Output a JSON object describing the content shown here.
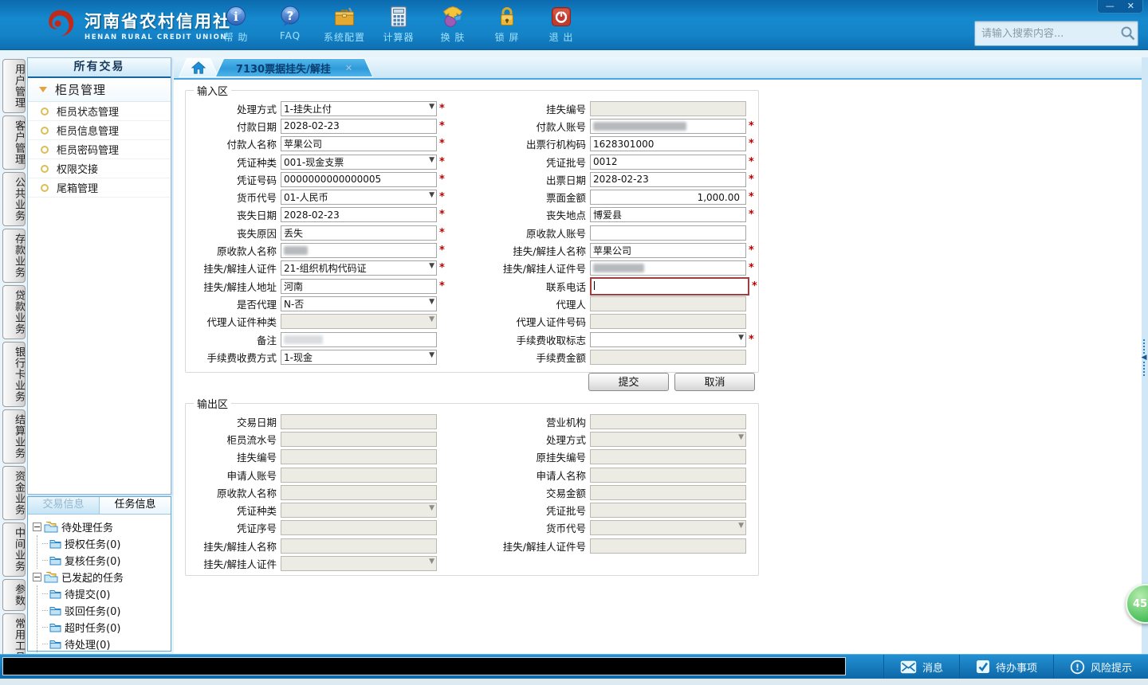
{
  "window": {
    "minimize": "—",
    "close": "✕"
  },
  "colors": {
    "header_blue": "#1583C8",
    "accent": "#2E9BDB",
    "required_red": "#C00000",
    "badge_green": "#52C260"
  },
  "header": {
    "brand_title": "河南省农村信用社",
    "brand_subtitle": "HENAN RURAL CREDIT UNION",
    "nav": [
      {
        "icon": "help-icon",
        "label": "帮 助"
      },
      {
        "icon": "faq-icon",
        "label": "FAQ"
      },
      {
        "icon": "settings-icon",
        "label": "系统配置"
      },
      {
        "icon": "calculator-icon",
        "label": "计算器"
      },
      {
        "icon": "skin-icon",
        "label": "换 肤"
      },
      {
        "icon": "lock-icon",
        "label": "锁 屏"
      },
      {
        "icon": "exit-icon",
        "label": "退 出"
      }
    ],
    "search_placeholder": "请输入搜索内容..."
  },
  "left_tabs": [
    "用户管理",
    "客户管理",
    "公共业务",
    "存款业务",
    "贷款业务",
    "银行卡业务",
    "结算业务",
    "资金业务",
    "中间业务",
    "参数",
    "常用工具"
  ],
  "sidebar": {
    "header": "所有交易",
    "group": "柜员管理",
    "items": [
      "柜员状态管理",
      "柜员信息管理",
      "柜员密码管理",
      "权限交接",
      "尾箱管理"
    ]
  },
  "tabs": {
    "active_label": "7130票据挂失/解挂",
    "close_glyph": "✕"
  },
  "form": {
    "required_mark": "*",
    "buttons": {
      "submit": "提交",
      "cancel": "取消"
    },
    "input": {
      "legend": "输入区",
      "rows": [
        {
          "left": {
            "name": "process-mode-select",
            "label": "处理方式",
            "value": "1-挂失止付",
            "type": "select",
            "required": true
          },
          "right": {
            "name": "loss-report-no-input",
            "label": "挂失编号",
            "value": "",
            "type": "text",
            "state": "disabled"
          }
        },
        {
          "left": {
            "name": "pay-date-input",
            "label": "付款日期",
            "value": "2028-02-23",
            "type": "text",
            "required": true
          },
          "right": {
            "name": "payer-account-input",
            "label": "付款人账号",
            "value": "",
            "type": "text",
            "state": "masked-wide",
            "required": true
          }
        },
        {
          "left": {
            "name": "payer-name-input",
            "label": "付款人名称",
            "value": "苹果公司",
            "type": "text",
            "required": true
          },
          "right": {
            "name": "issuing-bank-code-input",
            "label": "出票行机构码",
            "value": "1628301000",
            "type": "text",
            "required": true
          }
        },
        {
          "left": {
            "name": "voucher-type-select",
            "label": "凭证种类",
            "value": "001-现金支票",
            "type": "select",
            "required": true
          },
          "right": {
            "name": "voucher-batch-no-input",
            "label": "凭证批号",
            "value": "0012",
            "type": "text",
            "required": true
          }
        },
        {
          "left": {
            "name": "voucher-no-input",
            "label": "凭证号码",
            "value": "0000000000000005",
            "type": "text",
            "required": true
          },
          "right": {
            "name": "issue-date-input",
            "label": "出票日期",
            "value": "2028-02-23",
            "type": "text",
            "required": true
          }
        },
        {
          "left": {
            "name": "currency-select",
            "label": "货币代号",
            "value": "01-人民币",
            "type": "select",
            "required": true
          },
          "right": {
            "name": "face-amount-input",
            "label": "票面金额",
            "value": "1,000.00",
            "type": "text",
            "align": "right",
            "required": true
          }
        },
        {
          "left": {
            "name": "loss-date-input",
            "label": "丧失日期",
            "value": "2028-02-23",
            "type": "text",
            "required": true
          },
          "right": {
            "name": "loss-place-input",
            "label": "丧失地点",
            "value": "博爱县",
            "type": "text",
            "required": true
          }
        },
        {
          "left": {
            "name": "loss-reason-input",
            "label": "丧失原因",
            "value": "丢失",
            "type": "text",
            "required": true
          },
          "right": {
            "name": "original-payee-account-input",
            "label": "原收款人账号",
            "value": "",
            "type": "text"
          }
        },
        {
          "left": {
            "name": "original-payee-name-input",
            "label": "原收款人名称",
            "value": "",
            "type": "text",
            "state": "masked-sm",
            "required": true
          },
          "right": {
            "name": "applicant-name-input",
            "label": "挂失/解挂人名称",
            "value": "苹果公司",
            "type": "text",
            "required": true
          }
        },
        {
          "left": {
            "name": "applicant-cert-type-select",
            "label": "挂失/解挂人证件",
            "value": "21-组织机构代码证",
            "type": "select",
            "required": true
          },
          "right": {
            "name": "applicant-cert-no-input",
            "label": "挂失/解挂人证件号",
            "value": "",
            "type": "text",
            "state": "masked-med",
            "required": true
          }
        },
        {
          "left": {
            "name": "applicant-address-input",
            "label": "挂失/解挂人地址",
            "value": "河南",
            "type": "text",
            "required": true
          },
          "right": {
            "name": "contact-phone-input",
            "label": "联系电话",
            "value": "",
            "type": "text",
            "state": "focused",
            "required": true
          }
        },
        {
          "left": {
            "name": "is-agent-select",
            "label": "是否代理",
            "value": "N-否",
            "type": "select"
          },
          "right": {
            "name": "agent-name-input",
            "label": "代理人",
            "value": "",
            "type": "text",
            "state": "disabled"
          }
        },
        {
          "left": {
            "name": "agent-cert-type-select",
            "label": "代理人证件种类",
            "value": "",
            "type": "select",
            "state": "disabled"
          },
          "right": {
            "name": "agent-cert-no-input",
            "label": "代理人证件号码",
            "value": "",
            "type": "text",
            "state": "disabled"
          }
        },
        {
          "left": {
            "name": "remark-input",
            "label": "备注",
            "value": "",
            "type": "text",
            "state": "masked-light"
          },
          "right": {
            "name": "fee-charge-flag-select",
            "label": "手续费收取标志",
            "value": "",
            "type": "select",
            "required": true
          }
        },
        {
          "left": {
            "name": "fee-charge-mode-select",
            "label": "手续费收费方式",
            "value": "1-现金",
            "type": "select"
          },
          "right": {
            "name": "fee-amount-input",
            "label": "手续费金额",
            "value": "",
            "type": "text",
            "state": "disabled"
          }
        }
      ]
    },
    "output": {
      "legend": "输出区",
      "rows": [
        {
          "left": {
            "label": "交易日期",
            "value": "",
            "type": "text",
            "state": "disabled"
          },
          "right": {
            "label": "营业机构",
            "value": "",
            "type": "text",
            "state": "disabled"
          }
        },
        {
          "left": {
            "label": "柜员流水号",
            "value": "",
            "type": "text",
            "state": "disabled"
          },
          "right": {
            "label": "处理方式",
            "value": "",
            "type": "select",
            "state": "disabled"
          }
        },
        {
          "left": {
            "label": "挂失编号",
            "value": "",
            "type": "text",
            "state": "disabled"
          },
          "right": {
            "label": "原挂失编号",
            "value": "",
            "type": "text",
            "state": "disabled"
          }
        },
        {
          "left": {
            "label": "申请人账号",
            "value": "",
            "type": "text",
            "state": "disabled"
          },
          "right": {
            "label": "申请人名称",
            "value": "",
            "type": "text",
            "state": "disabled"
          }
        },
        {
          "left": {
            "label": "原收款人名称",
            "value": "",
            "type": "text",
            "state": "disabled"
          },
          "right": {
            "label": "交易金额",
            "value": "",
            "type": "text",
            "state": "disabled"
          }
        },
        {
          "left": {
            "label": "凭证种类",
            "value": "",
            "type": "select",
            "state": "disabled"
          },
          "right": {
            "label": "凭证批号",
            "value": "",
            "type": "text",
            "state": "disabled"
          }
        },
        {
          "left": {
            "label": "凭证序号",
            "value": "",
            "type": "text",
            "state": "disabled"
          },
          "right": {
            "label": "货币代号",
            "value": "",
            "type": "select",
            "state": "disabled"
          }
        },
        {
          "left": {
            "label": "挂失/解挂人名称",
            "value": "",
            "type": "text",
            "state": "disabled"
          },
          "right": {
            "label": "挂失/解挂人证件号",
            "value": "",
            "type": "text",
            "state": "disabled"
          }
        },
        {
          "left": {
            "label": "挂失/解挂人证件",
            "value": "",
            "type": "select",
            "state": "disabled"
          },
          "right": null
        }
      ]
    }
  },
  "task_panel": {
    "tabs": [
      {
        "label": "交易信息",
        "active": false
      },
      {
        "label": "任务信息",
        "active": true
      }
    ],
    "tree": [
      {
        "label": "待处理任务",
        "children": [
          "授权任务(0)",
          "复核任务(0)"
        ]
      },
      {
        "label": "已发起的任务",
        "children": [
          "待提交(0)",
          "驳回任务(0)",
          "超时任务(0)",
          "待处理(0)"
        ]
      }
    ]
  },
  "statusbar": {
    "items": [
      {
        "icon": "message-icon",
        "label": "消息"
      },
      {
        "icon": "todo-icon",
        "label": "待办事项"
      },
      {
        "icon": "risk-icon",
        "label": "风险提示"
      }
    ]
  },
  "badge": {
    "text": "45"
  }
}
